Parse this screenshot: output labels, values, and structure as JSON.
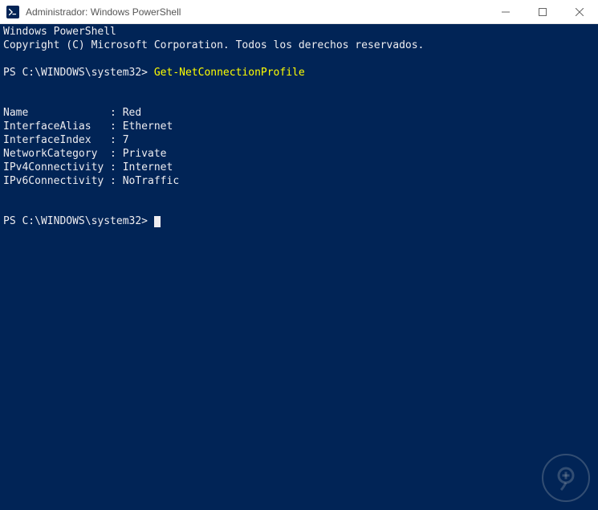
{
  "titlebar": {
    "title": "Administrador: Windows PowerShell"
  },
  "terminal": {
    "header_line1": "Windows PowerShell",
    "header_line2": "Copyright (C) Microsoft Corporation. Todos los derechos reservados.",
    "prompt1": "PS C:\\WINDOWS\\system32> ",
    "command1": "Get-NetConnectionProfile",
    "output": {
      "rows": [
        {
          "key": "Name",
          "value": "Red"
        },
        {
          "key": "InterfaceAlias",
          "value": "Ethernet"
        },
        {
          "key": "InterfaceIndex",
          "value": "7"
        },
        {
          "key": "NetworkCategory",
          "value": "Private"
        },
        {
          "key": "IPv4Connectivity",
          "value": "Internet"
        },
        {
          "key": "IPv6Connectivity",
          "value": "NoTraffic"
        }
      ]
    },
    "prompt2": "PS C:\\WINDOWS\\system32> "
  }
}
